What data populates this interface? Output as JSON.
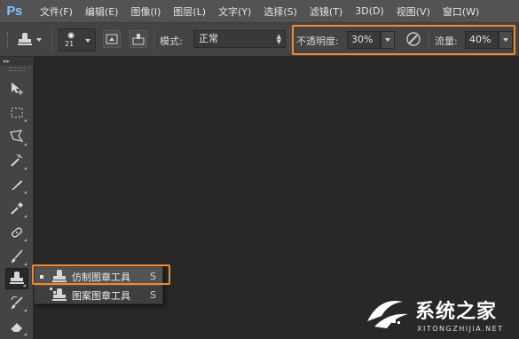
{
  "app": {
    "logo": "Ps"
  },
  "menu": {
    "items": [
      "文件(F)",
      "编辑(E)",
      "图像(I)",
      "图层(L)",
      "文字(Y)",
      "选择(S)",
      "滤镜(T)",
      "3D(D)",
      "视图(V)",
      "窗口(W)"
    ]
  },
  "options_bar": {
    "tool_icon": "clone-stamp-icon",
    "brush_size": "21",
    "mode_label": "模式:",
    "mode_value": "正常",
    "opacity_label": "不透明度:",
    "opacity_value": "30%",
    "flow_label": "流量:",
    "flow_value": "40%",
    "pressure_icon": "pen-pressure-icon"
  },
  "tool_panel": {
    "collapse_glyph": "▸▸",
    "tools": [
      {
        "name": "move-tool",
        "icon": "move-icon"
      },
      {
        "name": "marquee-tool",
        "icon": "rect-marquee-icon"
      },
      {
        "name": "lasso-tool",
        "icon": "polygon-lasso-icon"
      },
      {
        "name": "magic-wand-tool",
        "icon": "magic-wand-icon"
      },
      {
        "name": "crop-tool",
        "icon": "slice-icon"
      },
      {
        "name": "eyedropper-tool",
        "icon": "eyedropper-icon"
      },
      {
        "name": "healing-brush-tool",
        "icon": "bandage-icon"
      },
      {
        "name": "brush-tool",
        "icon": "brush-icon"
      },
      {
        "name": "clone-stamp-tool",
        "icon": "clone-stamp-icon",
        "active": true
      },
      {
        "name": "history-brush-tool",
        "icon": "history-brush-icon"
      },
      {
        "name": "eraser-tool",
        "icon": "eraser-icon"
      }
    ]
  },
  "flyout": {
    "items": [
      {
        "label": "仿制图章工具",
        "shortcut": "S",
        "selected": true
      },
      {
        "label": "图案图章工具",
        "shortcut": "S",
        "selected": false
      }
    ]
  },
  "watermark": {
    "title": "系统之家",
    "subtitle": "XITONGZHIJIA.NET"
  },
  "colors": {
    "highlight": "#ef8a32",
    "menubar": "#535353",
    "canvas": "#282828"
  }
}
